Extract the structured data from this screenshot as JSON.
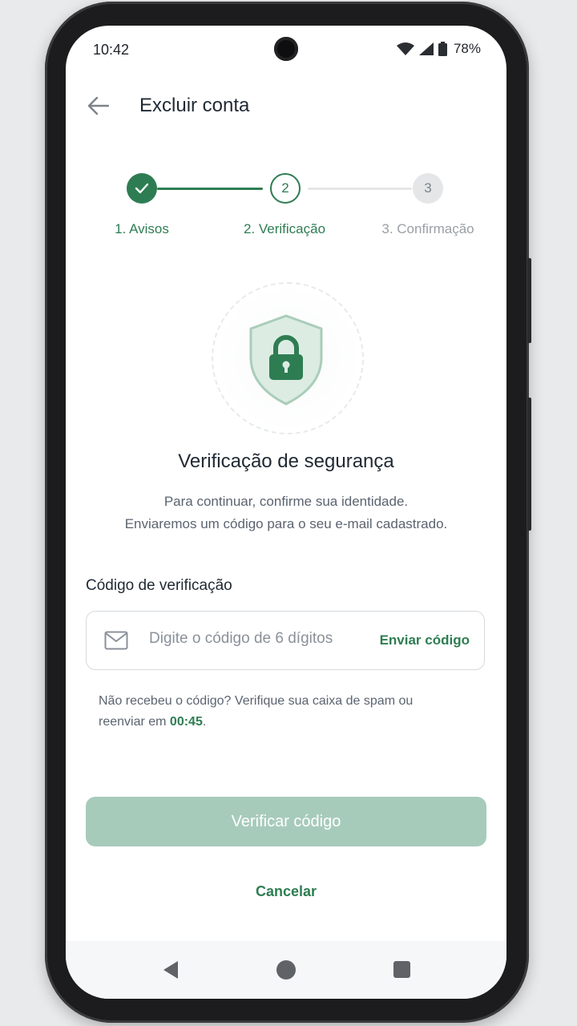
{
  "status_bar": {
    "time": "10:42",
    "battery": "78%"
  },
  "app_bar": {
    "title": "Excluir conta"
  },
  "stepper": {
    "steps": [
      {
        "number": "1",
        "label": "1. Avisos",
        "state": "done"
      },
      {
        "number": "2",
        "label": "2. Verificação",
        "state": "current"
      },
      {
        "number": "3",
        "label": "3. Confirmação",
        "state": "pending"
      }
    ]
  },
  "content": {
    "heading": "Verificação de segurança",
    "description_line1": "Para continuar, confirme sua identidade.",
    "description_line2": "Enviaremos um código para o seu e-mail cadastrado.",
    "field_label": "Código de verificação",
    "field_placeholder": "Digite o código de 6 dígitos",
    "field_value": "",
    "send_code": "Enviar código",
    "hint_text": "Não recebeu o código? Verifique sua caixa de spam ou reenviar em ",
    "hint_timer": "00:45",
    "hint_end": ".",
    "verify_button": "Verificar código",
    "cancel": "Cancelar"
  },
  "colors": {
    "accent": "#2e7d52",
    "accent_light": "#a7cbbb",
    "pending": "#e4e6e8",
    "text_dark": "#1f2933",
    "text_muted": "#5b6470"
  },
  "icons": [
    "back-arrow-icon",
    "check-icon",
    "shield-lock-icon",
    "mail-icon",
    "wifi-icon",
    "signal-icon",
    "battery-icon",
    "nav-back-icon",
    "nav-home-icon",
    "nav-recents-icon"
  ]
}
